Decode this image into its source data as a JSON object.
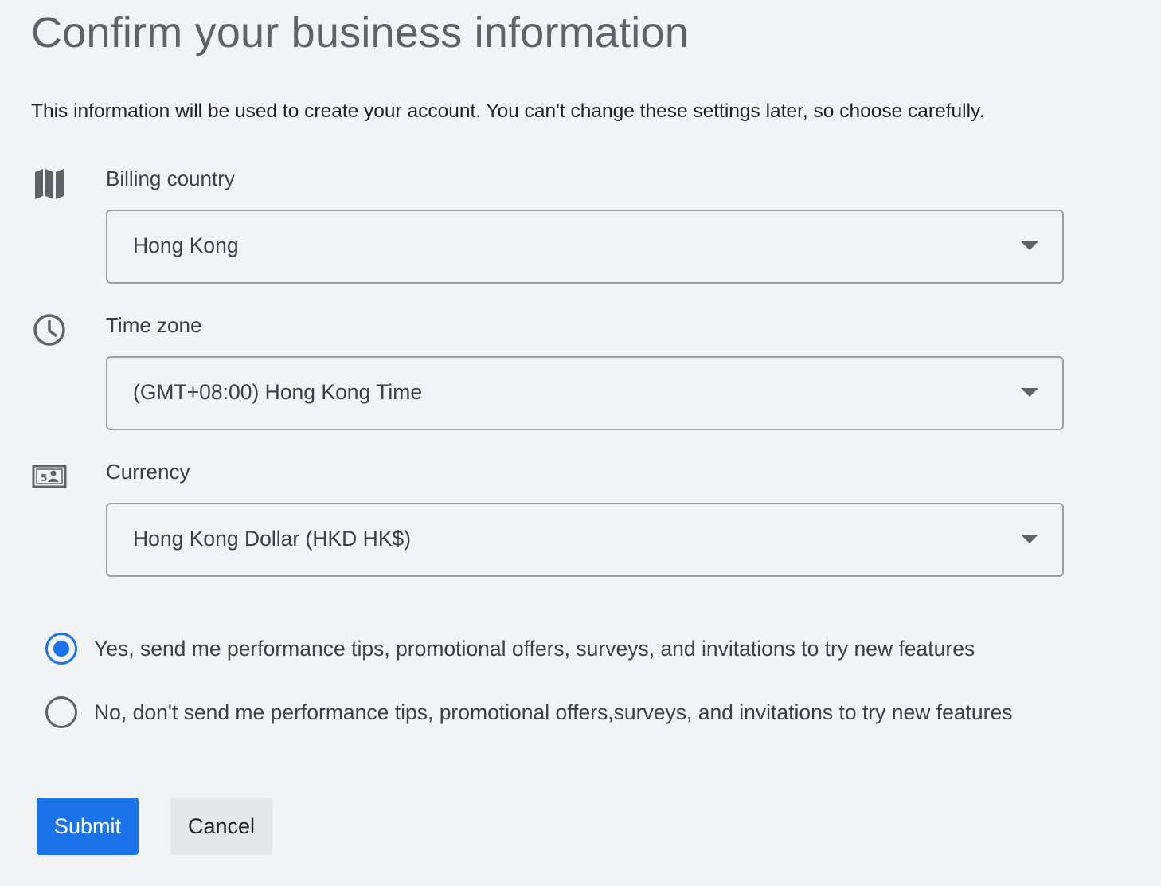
{
  "page": {
    "title": "Confirm your business information",
    "intro": "This information will be used to create your account. You can't change these settings later, so choose carefully."
  },
  "fields": {
    "billing_country": {
      "label": "Billing country",
      "value": "Hong Kong",
      "icon": "map-icon"
    },
    "time_zone": {
      "label": "Time zone",
      "value": "(GMT+08:00) Hong Kong Time",
      "icon": "clock-icon"
    },
    "currency": {
      "label": "Currency",
      "value": "Hong Kong Dollar (HKD HK$)",
      "icon": "money-icon"
    }
  },
  "email_prefs": {
    "selected": "yes",
    "options": [
      {
        "id": "yes",
        "label": "Yes, send me performance tips, promotional offers, surveys, and invitations to try new features"
      },
      {
        "id": "no",
        "label": "No, don't send me performance tips, promotional offers,surveys, and invitations to try new features"
      }
    ]
  },
  "actions": {
    "submit_label": "Submit",
    "cancel_label": "Cancel"
  },
  "colors": {
    "accent": "#1a73e8",
    "background": "#f2f3f5",
    "icon": "#5f6368"
  }
}
